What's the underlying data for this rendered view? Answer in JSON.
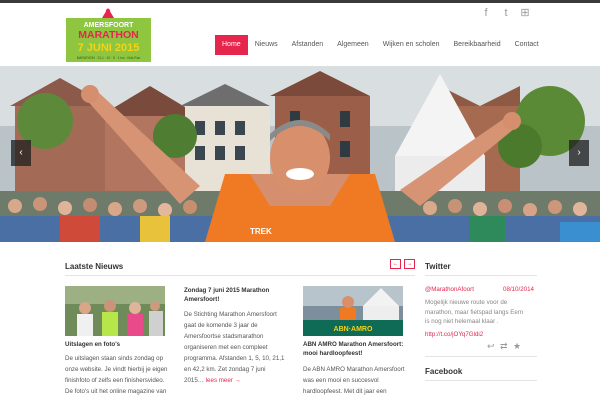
{
  "logo": {
    "line1": "AMERSFOORT",
    "line2": "MARATHON",
    "line3": "7 JUNI 2015",
    "tagline": "MARATHON · 21,1 · 10 · 5 · 1 km · Kids Run"
  },
  "social": [
    {
      "name": "facebook-icon",
      "glyph": "f"
    },
    {
      "name": "twitter-icon",
      "glyph": "t"
    },
    {
      "name": "grid-icon",
      "glyph": "⊞"
    }
  ],
  "nav": {
    "items": [
      "Home",
      "Nieuws",
      "Afstanden",
      "Algemeen",
      "Wijken en scholen",
      "Bereikbaarheid",
      "Contact"
    ]
  },
  "hero": {
    "prev_glyph": "‹",
    "next_glyph": "›",
    "bib_text": "TREK"
  },
  "news": {
    "title": "Laatste Nieuws",
    "prev_glyph": "←",
    "next_glyph": "→",
    "articles": [
      {
        "title": "Uitslagen en foto's",
        "lines": [
          "De uitslagen staan sinds zondag op",
          "onze website. Je vindt hierbij je eigen",
          "finishfoto of zelfs een finishersvideo.",
          "De foto's uit het online magazine van"
        ]
      },
      {
        "title_lines": [
          "Zondag 7 juni 2015 Marathon",
          "Amersfoort!"
        ],
        "lines": [
          "De Stichting Marathon Amersfoort",
          "gaat de komende 3 jaar de",
          "Amersfoortse stadsmarathon",
          "organiseren met een compleet",
          "programma. Afstanden 1, 5, 10, 21,1",
          "en 42,2 km. Zet zondag 7 juni",
          "2015…"
        ],
        "more": "lees meer →"
      },
      {
        "title_lines": [
          "ABN AMRO Marathon Amersfoort:",
          "mooi hardloopfeest!"
        ],
        "lines": [
          "De ABN AMRO Marathon Amersfoort",
          "was een mooi en succesvol",
          "hardloopfeest. Met dit jaar een"
        ],
        "banner": "ABN·AMRO"
      }
    ]
  },
  "twitter": {
    "title": "Twitter",
    "handle": "@MarathonAfoort",
    "date": "08/10/2014",
    "text_lines": [
      "Mogelijk nieuwe route voor de",
      "marathon, maar fietspad langs Eem",
      "is nog niet helemaal klaar ."
    ],
    "link": "http://t.co/jOYq7Gldi2",
    "reply_glyph": "↩",
    "retweet_glyph": "⇄",
    "favorite_glyph": "★"
  },
  "facebook": {
    "title": "Facebook"
  },
  "colors": {
    "accent": "#e6264d",
    "logo_green": "#8ec640",
    "logo_yellow": "#f5d316",
    "topbar": "#3a3a3a"
  }
}
